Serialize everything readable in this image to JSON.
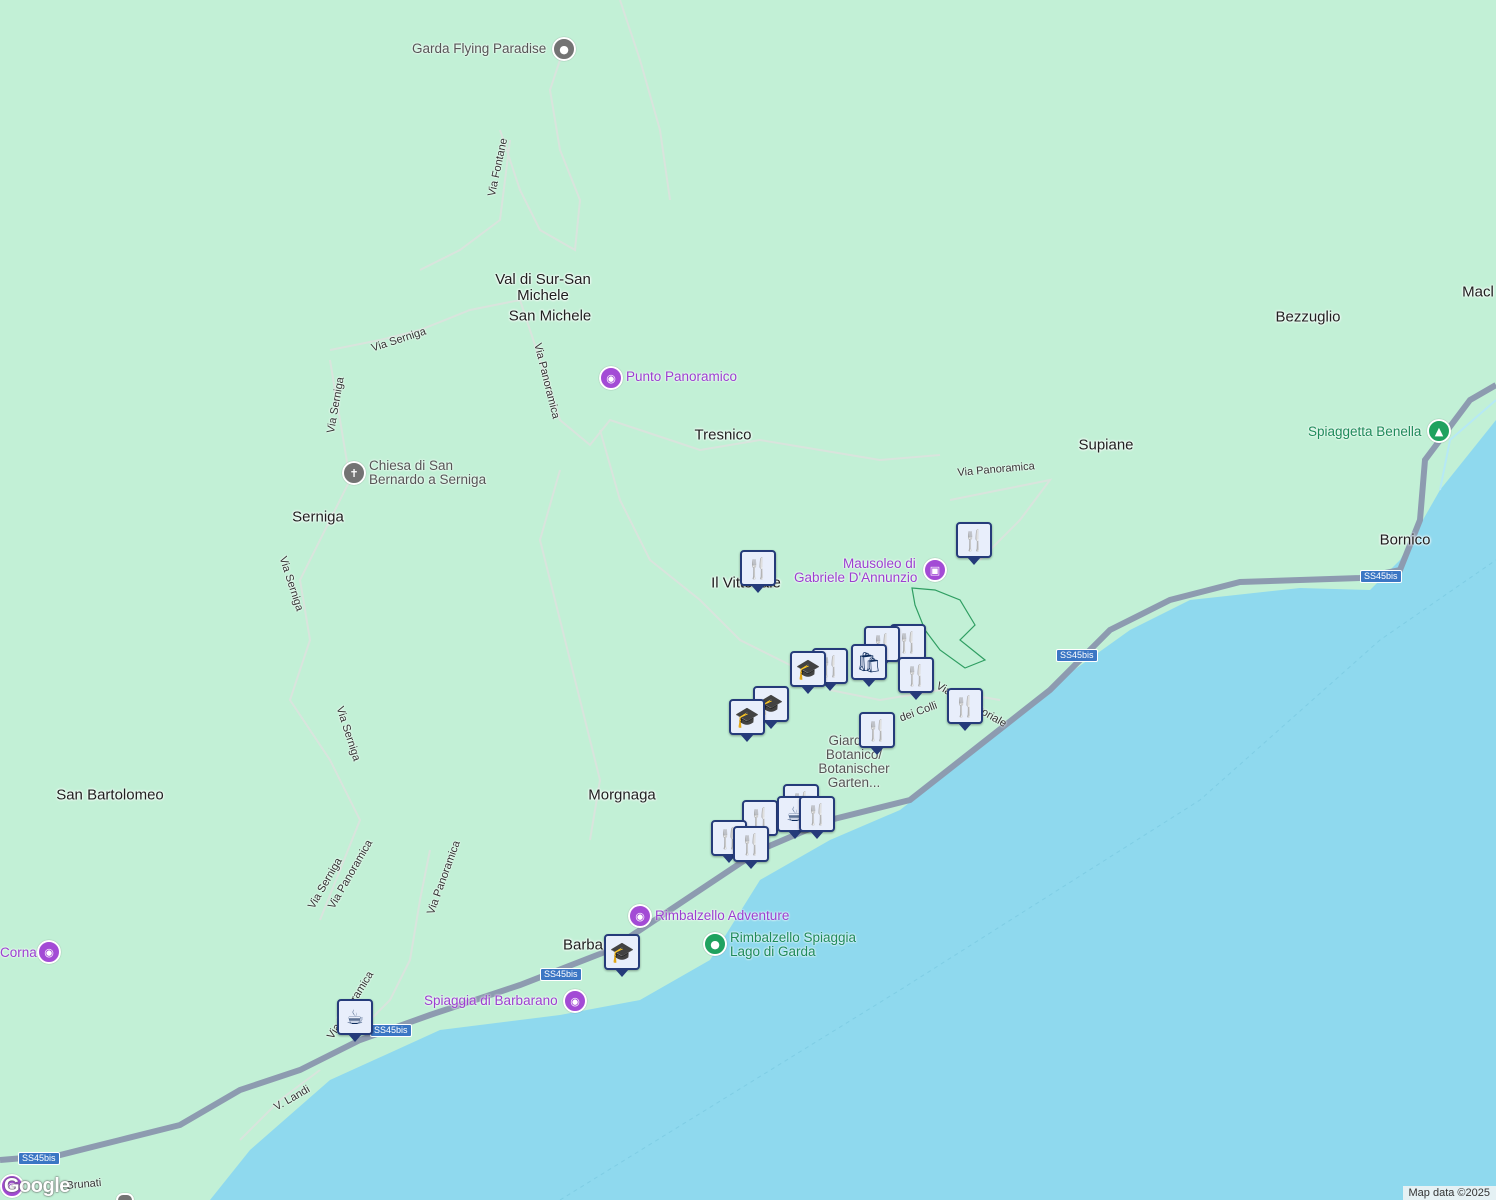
{
  "map": {
    "attribution": "Map data ©2025",
    "logo_text": "Google",
    "colors": {
      "land": "#c2f0d6",
      "water": "#8fd9ee",
      "road": "#8d9bb0",
      "marker_border": "#253b7a"
    },
    "places": {
      "val_di_sur": "Val di Sur-San Michele",
      "san_michele": "San Michele",
      "tresnico": "Tresnico",
      "serniga": "Serniga",
      "il_vittoriale": "Il Vittoriale",
      "morgnaga": "Morgnaga",
      "san_bartolomeo": "San Bartolomeo",
      "barbarano": "Barbarano",
      "supiane": "Supiane",
      "bezzuglio": "Bezzuglio",
      "bornico": "Bornico",
      "macl": "Macl"
    },
    "pois": {
      "garda_flying": "Garda Flying Paradise",
      "punto_panoramico": "Punto Panoramico",
      "chiesa_line1": "Chiesa di San",
      "chiesa_line2": "Bernardo a Serniga",
      "mausoleo_line1": "Mausoleo di",
      "mausoleo_line2": "Gabriele D'Annunzio",
      "giardino": "Giardino Botanico/ Botanischer Garten...",
      "rimbalzello_adventure": "Rimbalzello Adventure",
      "rimbalzello_spiaggia_line1": "Rimbalzello Spiaggia",
      "rimbalzello_spiaggia_line2": "Lago di Garda",
      "spiaggia_barbarano": "Spiaggia di Barbarano",
      "spiaggetta_benella": "Spiaggetta Benella",
      "corna": "Corna"
    },
    "roads": {
      "via_fontane": "Via Fontane",
      "via_serniga": "Via Serniga",
      "via_panoramica": "Via Panoramica",
      "via_dei_colli": "dei Colli",
      "via_vittoriale": "Via del Vittoriale",
      "v_landi": "V. Landi",
      "brunati": "Brunati",
      "ss45bis": "SS45bis"
    },
    "marker_icons": {
      "restaurant": "restaurant-icon",
      "school": "school-icon",
      "shopping": "shopping-bag-icon",
      "cafe": "cafe-icon"
    }
  }
}
